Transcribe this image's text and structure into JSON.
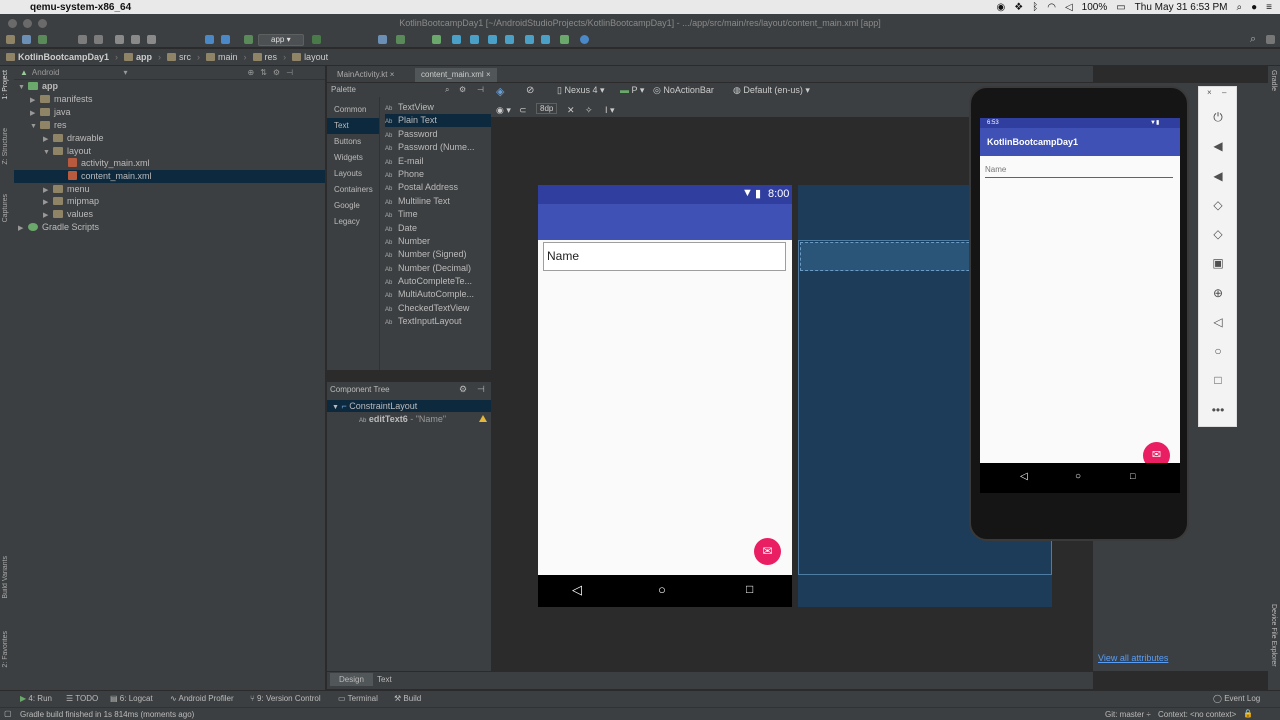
{
  "menubar": {
    "app_name": "qemu-system-x86_64",
    "battery": "100%",
    "clock": "Thu May 31  6:53 PM"
  },
  "window": {
    "title": "KotlinBootcampDay1 [~/AndroidStudioProjects/KotlinBootcampDay1] - .../app/src/main/res/layout/content_main.xml [app]"
  },
  "toolbar": {
    "run_config": "app"
  },
  "breadcrumb": {
    "items": [
      "KotlinBootcampDay1",
      "app",
      "src",
      "main",
      "res",
      "layout"
    ]
  },
  "left_strip": {
    "tabs": [
      "1: Project",
      "Z: Structure",
      "Captures",
      "Build Variants",
      "2: Favorites"
    ]
  },
  "project": {
    "view_mode": "Android",
    "tree": [
      {
        "label": "app"
      },
      {
        "label": "manifests"
      },
      {
        "label": "java"
      },
      {
        "label": "res"
      },
      {
        "label": "drawable"
      },
      {
        "label": "layout"
      },
      {
        "label": "activity_main.xml"
      },
      {
        "label": "content_main.xml"
      },
      {
        "label": "menu"
      },
      {
        "label": "mipmap"
      },
      {
        "label": "values"
      },
      {
        "label": "Gradle Scripts"
      }
    ]
  },
  "editor_tabs": [
    "MainActivity.kt",
    "content_main.xml"
  ],
  "palette": {
    "title": "Palette",
    "categories": [
      "Common",
      "Text",
      "Buttons",
      "Widgets",
      "Layouts",
      "Containers",
      "Google",
      "Legacy"
    ],
    "items": [
      "TextView",
      "Plain Text",
      "Password",
      "Password (Nume...",
      "E-mail",
      "Phone",
      "Postal Address",
      "Multiline Text",
      "Time",
      "Date",
      "Number",
      "Number (Signed)",
      "Number (Decimal)",
      "AutoCompleteTe...",
      "MultiAutoComple...",
      "CheckedTextView",
      "TextInputLayout"
    ]
  },
  "component_tree": {
    "title": "Component Tree",
    "root": "ConstraintLayout",
    "child_id": "editText6",
    "child_value": "- \"Name\""
  },
  "design_toolbar": {
    "device": "Nexus 4",
    "api": "P",
    "theme": "NoActionBar",
    "locale": "Default (en-us)",
    "margin": "8dp"
  },
  "design_preview": {
    "time": "8:00",
    "field_text": "Name"
  },
  "emulator": {
    "time": "6:53",
    "app_title": "KotlinBootcampDay1",
    "field_hint": "Name"
  },
  "attributes": {
    "view_all": "View all attributes"
  },
  "editor_bottom_tabs": [
    "Design",
    "Text"
  ],
  "bottom_tabs": [
    "4: Run",
    "TODO",
    "6: Logcat",
    "Android Profiler",
    "9: Version Control",
    "Terminal",
    "Build",
    "Event Log"
  ],
  "status": {
    "message": "Gradle build finished in 1s 814ms (moments ago)",
    "git": "Git: master ÷",
    "context": "Context: <no context>"
  },
  "right_strip": {
    "tabs": [
      "Gradle",
      "Device File Explorer"
    ]
  },
  "colors": {
    "primary": "#3f51b5",
    "primary_dark": "#303f9f",
    "accent": "#e91e63",
    "ide_bg": "#3c3f41",
    "selection": "#0d293e"
  }
}
